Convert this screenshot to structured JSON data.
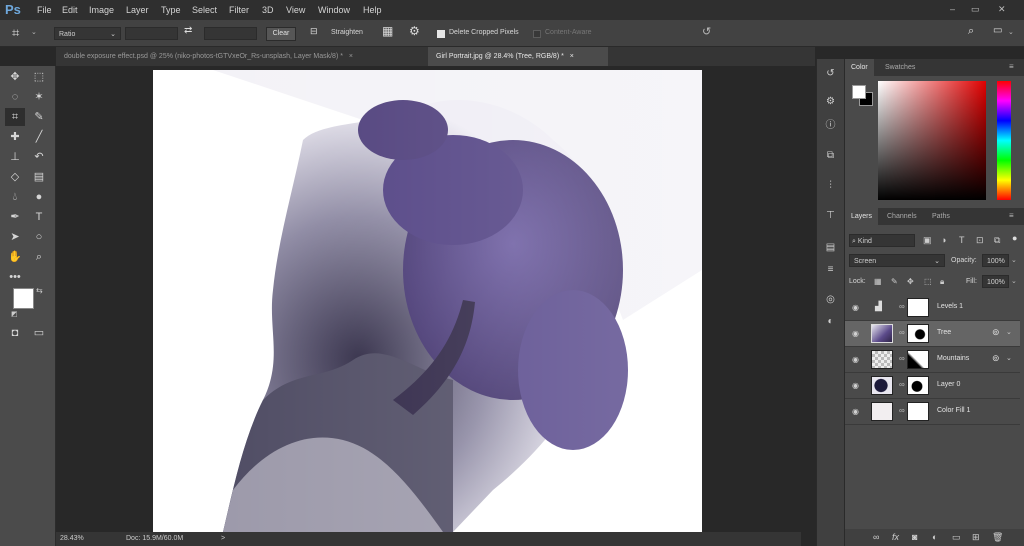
{
  "app": {
    "logo": "Ps"
  },
  "menu": [
    "File",
    "Edit",
    "Image",
    "Layer",
    "Type",
    "Select",
    "Filter",
    "3D",
    "View",
    "Window",
    "Help"
  ],
  "window_controls": {
    "minimize": "–",
    "restore": "▭",
    "close": "✕"
  },
  "options": {
    "ratio_label": "Ratio",
    "clear_label": "Clear",
    "straighten_label": "Straighten",
    "delete_cropped_label": "Delete Cropped Pixels",
    "delete_cropped_checked": true,
    "content_aware_label": "Content-Aware",
    "content_aware_checked": false
  },
  "tabs": [
    {
      "label": "double exposure effect.psd @ 25% (niko-photos-tGTVxeOr_Rs-unsplash, Layer Mask/8) *",
      "active": false,
      "close": "×"
    },
    {
      "label": "Girl Portrait.jpg @ 28.4% (Tree, RGB/8) *",
      "active": true,
      "close": "×"
    }
  ],
  "status": {
    "zoom": "28.43%",
    "doc": "Doc: 15.9M/60.0M",
    "arrow": ">"
  },
  "color_panel": {
    "tabs": [
      "Color",
      "Swatches"
    ],
    "foreground": "#ffffff",
    "background": "#000000"
  },
  "layers_panel": {
    "tabs": [
      "Layers",
      "Channels",
      "Paths"
    ],
    "filter_kind": "Kind",
    "blend_mode": "Screen",
    "opacity_label": "Opacity:",
    "opacity_value": "100%",
    "lock_label": "Lock:",
    "fill_label": "Fill:",
    "fill_value": "100%",
    "layers": [
      {
        "name": "Levels 1",
        "selected": false
      },
      {
        "name": "Tree",
        "selected": true
      },
      {
        "name": "Mountains",
        "selected": false
      },
      {
        "name": "Layer 0",
        "selected": false
      },
      {
        "name": "Color Fill 1",
        "selected": false
      }
    ]
  },
  "bottom_icons": [
    "link-icon",
    "fx-icon",
    "mask-icon",
    "adjustment-icon",
    "folder-icon",
    "new-layer-icon",
    "trash-icon"
  ],
  "accent_colors": {
    "tree_purple": "#4a3a7a",
    "mist": "#d8d3e6"
  }
}
